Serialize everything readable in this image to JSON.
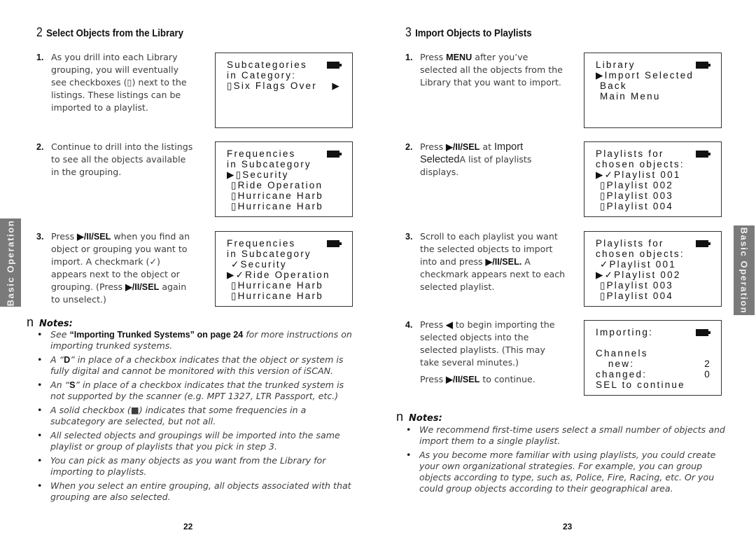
{
  "left_page": {
    "section_number": "2",
    "section_title": "Select Objects from the Library",
    "steps": [
      {
        "num": "1.",
        "text": "As you drill into each Library grouping, you will eventually see checkboxes (▯) next to the listings. These listings can be imported to a playlist."
      },
      {
        "num": "2.",
        "text": "Continue to drill into the listings to see all the objects available in the grouping."
      },
      {
        "num": "3.",
        "pre": "Press ",
        "key1": "▶/II/SEL",
        "mid": " when you find an object or grouping you want to import. A checkmark (✓) appears next to the object or grouping. (Press ",
        "key2": "▶/II/SEL",
        "post": " again to unselect.)"
      }
    ],
    "screens": [
      {
        "lines": [
          "Subcategories",
          "in Category:",
          "▯Six Flags Over"
        ],
        "arrow_right": "▶"
      },
      {
        "lines": [
          "Frequencies",
          "in Subcategory",
          "▶▯Security",
          " ▯Ride Operation",
          " ▯Hurricane Harb",
          " ▯Hurricane Harb"
        ]
      },
      {
        "lines": [
          "Frequencies",
          "in Subcategory",
          " ✓Security",
          "▶✓Ride Operation",
          " ▯Hurricane Harb",
          " ▯Hurricane Harb"
        ]
      }
    ],
    "notes_label": "Notes:",
    "notes_glyph": "n",
    "notes": [
      {
        "pre": "See ",
        "bold": "“Importing Trunked Systems” on page 24",
        "post": " for more instructions on importing trunked systems."
      },
      {
        "pre": "A “",
        "bold": "D",
        "post": "” in place of a checkbox indicates that the object or system is fully digital and cannot be monitored with this version of iSCAN."
      },
      {
        "pre": "An “",
        "bold": "S",
        "post": "” in place of a checkbox indicates that the trunked system is not supported by the scanner (e.g. MPT 1327, LTR Passport, etc.)"
      },
      {
        "pre": "A solid checkbox (■) indicates that some frequencies in a subcategory are selected, but not all.",
        "bold": "",
        "post": ""
      },
      {
        "pre": "All selected objects and groupings will be imported into the same playlist or group of playlists that you pick in step 3.",
        "bold": "",
        "post": ""
      },
      {
        "pre": "You can pick as many objects as you want from the Library for importing to playlists.",
        "bold": "",
        "post": ""
      },
      {
        "pre": "When you select an entire grouping, all objects associated with that grouping are also selected.",
        "bold": "",
        "post": ""
      }
    ],
    "page_number": "22",
    "side_tab": "Basic Operation"
  },
  "right_page": {
    "section_number": "3",
    "section_title": "Import Objects to Playlists",
    "steps": [
      {
        "num": "1.",
        "pre": "Press ",
        "key1": "MENU",
        "post": " after you’ve selected all the objects from the Library that you want to import."
      },
      {
        "num": "2.",
        "pre": "Press ",
        "key1": "▶/II/SEL",
        "mid": " at ",
        "lcd_text": "Import Selected",
        "post": "A list of playlists displays."
      },
      {
        "num": "3.",
        "pre": "Scroll to each playlist you want the selected objects to import into and press ",
        "key1": "▶/II/SEL.",
        "post": " A checkmark appears next to each selected playlist."
      },
      {
        "num": "4.",
        "pre": "Press ",
        "key1": "◀",
        "post": " to begin importing the selected objects into the selected playlists. (This may take several minutes.)",
        "pre2": "Press ",
        "key2": "▶/II/SEL",
        "post2": " to continue."
      }
    ],
    "screens": [
      {
        "lines": [
          "Library",
          "▶Import Selected",
          " Back",
          " Main Menu"
        ]
      },
      {
        "lines": [
          "Playlists for",
          "chosen objects:",
          "▶✓Playlist 001",
          " ▯Playlist 002",
          " ▯Playlist 003",
          " ▯Playlist 004"
        ]
      },
      {
        "lines": [
          "Playlists for",
          "chosen objects:",
          " ✓Playlist 001",
          "▶✓Playlist 002",
          " ▯Playlist 003",
          " ▯Playlist 004"
        ]
      },
      {
        "lines": [
          "Importing:",
          "",
          "Channels",
          "   new:",
          "changed:",
          "SEL to continue"
        ],
        "new_value": "2",
        "changed_value": "0"
      }
    ],
    "notes_label": "Notes:",
    "notes_glyph": "n",
    "notes": [
      "We recommend first-time users select a small number of objects and import them to a single playlist.",
      "As you become more familiar with using playlists, you could create your own organizational strategies. For example, you can group objects according to type, such as, Police, Fire, Racing, etc. Or you could group objects according to their geographical area."
    ],
    "page_number": "23",
    "side_tab": "Basic Operation"
  }
}
